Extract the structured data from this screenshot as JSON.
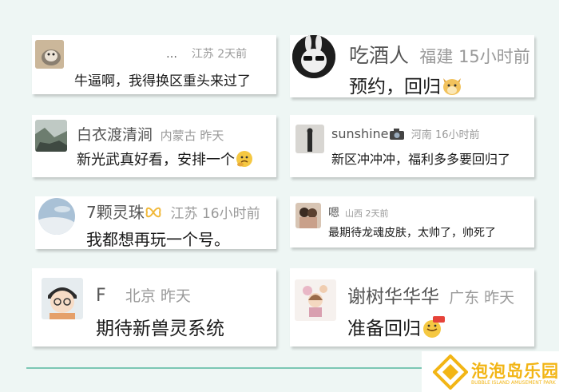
{
  "comments": [
    {
      "name": "…",
      "location": "江苏",
      "time": "2天前",
      "text": "牛逼啊，我得换区重头来过了",
      "avatar": "cat-avatar",
      "emoji": null
    },
    {
      "name": "吃酒人",
      "location": "福建",
      "time": "15小时前",
      "text": "预约，回归",
      "avatar": "rabbit-sunglasses-avatar",
      "emoji": "doge-emoji"
    },
    {
      "name": "白衣渡清涧",
      "location": "内蒙古",
      "time": "昨天",
      "text": "新光武真好看，安排一个",
      "avatar": "mountain-landscape-avatar",
      "emoji": "thinking-emoji"
    },
    {
      "name": "sunshine",
      "location": "河南",
      "time": "16小时前",
      "text": "新区冲冲冲，福利多多要回归了",
      "avatar": "dark-figure-avatar",
      "emoji": "camera-emoji"
    },
    {
      "name": "7颗灵珠",
      "location": "江苏",
      "time": "16小时前",
      "text": "我都想再玩一个号。",
      "avatar": "sky-photo-avatar",
      "emoji": "ribbon-emoji"
    },
    {
      "name": "嗯",
      "location": "山西",
      "time": "2天前",
      "text": "最期待龙魂皮肤，太帅了，帅死了",
      "avatar": "couple-photo-avatar",
      "emoji": null
    },
    {
      "name": "F",
      "location": "北京",
      "time": "昨天",
      "text": "期待新兽灵系统",
      "avatar": "cartoon-boy-avatar",
      "emoji": null
    },
    {
      "name": "谢树华华华",
      "location": "广东",
      "time": "昨天",
      "text": "准备回归",
      "avatar": "doll-avatar",
      "emoji": "666-emoji"
    }
  ],
  "brand": {
    "name": "泡泡岛乐园",
    "tagline": "BUBBLE ISLAND AMUSEMENT PARK",
    "color": "#f2b515"
  },
  "colors": {
    "background": "#eef6f4",
    "divider": "#7cc7b4"
  }
}
